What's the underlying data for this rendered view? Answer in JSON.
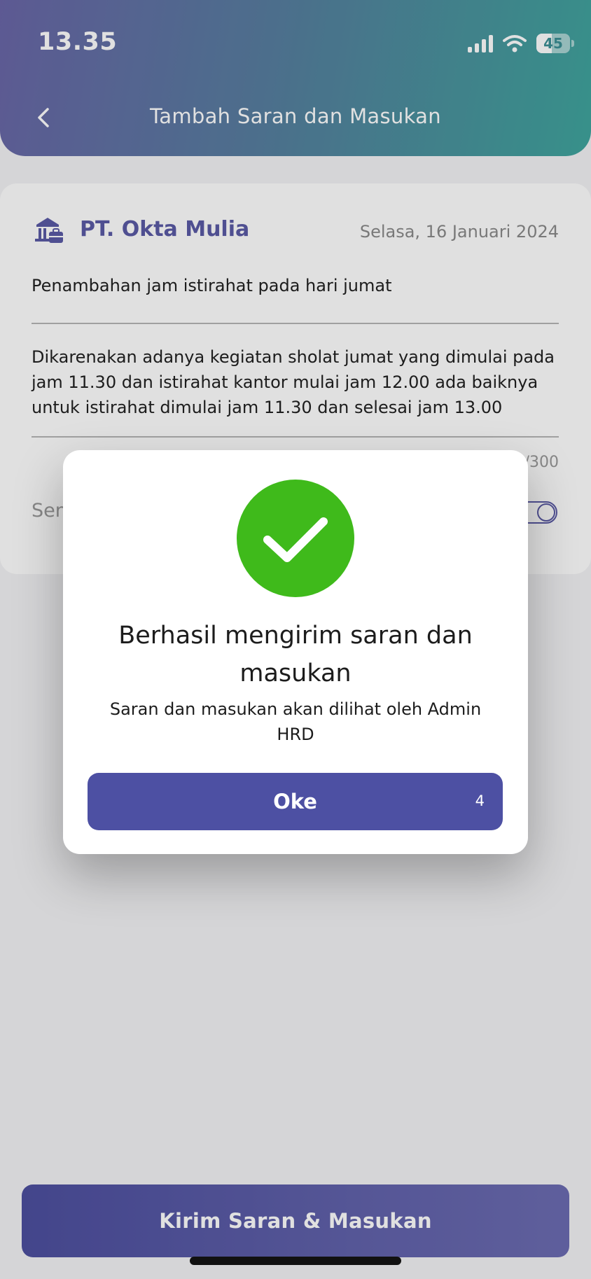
{
  "status_bar": {
    "time": "13.35",
    "battery": "45",
    "battery_level": 0.45
  },
  "header": {
    "title": "Tambah Saran dan Masukan",
    "back_icon": "chevron-left-icon"
  },
  "form": {
    "company_icon": "office-building-icon",
    "company": "PT. Okta Mulia",
    "date": "Selasa, 16 Januari 2024",
    "subject": "Penambahan jam istirahat pada hari jumat",
    "body_line_1": "Dikarenakan adanya kegiatan sholat jumat yang dimulai pada",
    "body_line_2": "jam 11.30 dan istirahat kantor mulai jam 12.00 ada baiknya",
    "body_line_3": "untuk istirahat dimulai jam 11.30 dan selesai jam 13.00",
    "char_counter": "/300",
    "anonymous_label": "Sen"
  },
  "submit": {
    "label": "Kirim Saran & Masukan"
  },
  "modal": {
    "icon": "check-circle-icon",
    "title": "Berhasil mengirim saran dan masukan",
    "message": "Saran dan masukan akan dilihat oleh Admin HRD",
    "ok_label": "Oke",
    "ok_countdown": "4"
  },
  "colors": {
    "primary": "#4d50a3",
    "success": "#3fba1b",
    "header_gradient_start": "#6a66a8",
    "header_gradient_end": "#3fa59e"
  }
}
